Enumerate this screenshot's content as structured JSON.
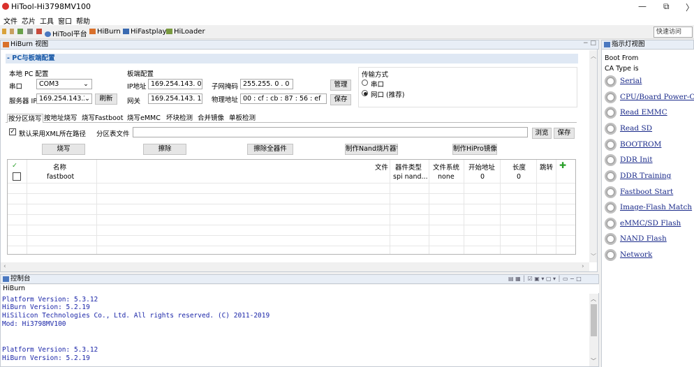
{
  "window": {
    "title": "HiTool-Hi3798MV100",
    "minimize": "—",
    "restore": "⧉",
    "chevron": "〉"
  },
  "menu": [
    "文件",
    "芯片",
    "工具",
    "窗口",
    "帮助"
  ],
  "toolbar": {
    "items": [
      "HiTool平台",
      "HiBurn",
      "HiFastplay",
      "HiLoader"
    ],
    "quick_access": "快速访问"
  },
  "hiburn_view": {
    "tab_label": "HiBurn 视图"
  },
  "pc_board": {
    "section_title": "- PC与板端配置",
    "local_pc": {
      "group_label": "本地 PC 配置",
      "serial_label": "串口",
      "serial_value": "COM3",
      "server_label": "服务器 IP",
      "server_value": "169.254.143.2",
      "refresh": "刷新"
    },
    "board": {
      "group_label": "板端配置",
      "ip_label": "IP地址",
      "ip_value": "169.254.143. 0",
      "mask_label": "子网掩码",
      "mask_value": "255.255. 0 . 0",
      "manage": "管理",
      "gateway_label": "网关",
      "gateway_value": "169.254.143. 1",
      "mac_label": "物理地址",
      "mac_value": "00 : cf : cb : 87 : 56 : ef",
      "save": "保存"
    },
    "transfer": {
      "group_label": "传输方式",
      "opt_serial": "串口",
      "opt_net": "网口 (推荐)",
      "selected": "net"
    }
  },
  "burn_tabs": [
    "按分区烧写",
    "按地址烧写",
    "烧写Fastboot",
    "烧写eMMC",
    "坏块检测",
    "合并镜像",
    "单板检测"
  ],
  "burn_partition": {
    "use_default_xml": "默认采用XML所在路径",
    "partition_file_label": "分区表文件",
    "partition_file_value": "",
    "browse": "浏览",
    "save": "保存",
    "actions": [
      "烧写",
      "擦除",
      "擦除全器件",
      "制作Nand烧片器镜像",
      "制作HiPro镜像"
    ],
    "columns": [
      "名称",
      "文件",
      "器件类型",
      "文件系统",
      "开始地址",
      "长度",
      "跳转"
    ],
    "rows": [
      {
        "name": "fastboot",
        "file": "",
        "device": "spi nand...",
        "fs": "none",
        "start": "0",
        "length": "0",
        "jump": ""
      }
    ]
  },
  "console": {
    "tab_label": "控制台",
    "sub_label": "HiBurn",
    "lines": [
      "Platform Version: 5.3.12",
      "HiBurn Version: 5.2.19",
      "HiSilicon Technologies Co., Ltd. All rights reserved. (C) 2011-2019",
      "Mod: Hi3798MV100",
      "",
      "",
      "Platform Version: 5.3.12",
      "HiBurn Version: 5.2.19"
    ]
  },
  "indicator": {
    "tab_label": "指示灯视图",
    "boot_from": "Boot From",
    "ca_type": "CA Type is",
    "items": [
      "Serial",
      "CPU/Board Power-On",
      "Read EMMC",
      "Read SD",
      "BOOTROM",
      "DDR Init",
      "DDR Training",
      "Fastboot Start",
      "Image-Flash Match",
      "eMMC/SD Flash",
      "NAND Flash",
      "Network"
    ]
  },
  "colors": {
    "accent": "#1a5aa8",
    "link": "#1a2a8a",
    "console_text": "#1a25a8",
    "add": "#2aa02a"
  }
}
